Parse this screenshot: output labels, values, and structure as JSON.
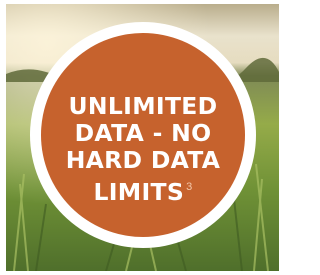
{
  "badge": {
    "line1": "UNLIMITED",
    "line2": "DATA - NO",
    "line3": "HARD DATA",
    "line4": "LIMITS",
    "footnote": "3",
    "color": "#c6622d"
  },
  "background": {
    "sky_color": "#e8e2cf",
    "field_color": "#8ca53f"
  }
}
